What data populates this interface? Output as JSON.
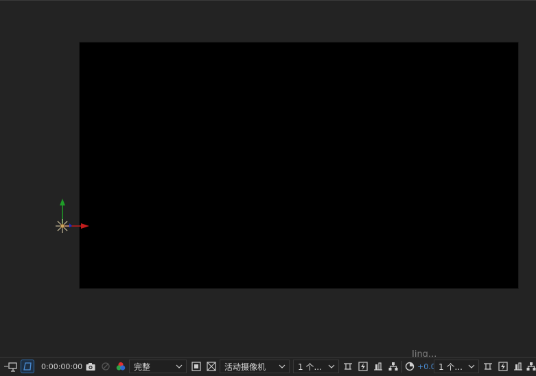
{
  "viewer": {
    "axis_colors": {
      "x": "#c21c1c",
      "y": "#1f9e28",
      "z": "#1c2fc4"
    }
  },
  "toolbar": {
    "timecode": "0:00:00:00",
    "resolution": {
      "selected": "完整"
    },
    "view": {
      "selected": "活动摄像机"
    },
    "views_count": {
      "selected": "1 个..."
    },
    "exposure_offset": "+0.0",
    "views_count_2": {
      "selected": "1 个..."
    },
    "ghost_label": "Jing..."
  },
  "icons": [
    "region-of-interest-icon",
    "transparency-grid-icon",
    "snapshot-icon",
    "show-snapshot-icon",
    "color-channel-icon",
    "toggle-mask-icon",
    "checkerboard-icon",
    "draft3d-icon",
    "fast-preview-icon",
    "timeline-icon",
    "flowchart-icon",
    "reset-exposure-icon"
  ]
}
